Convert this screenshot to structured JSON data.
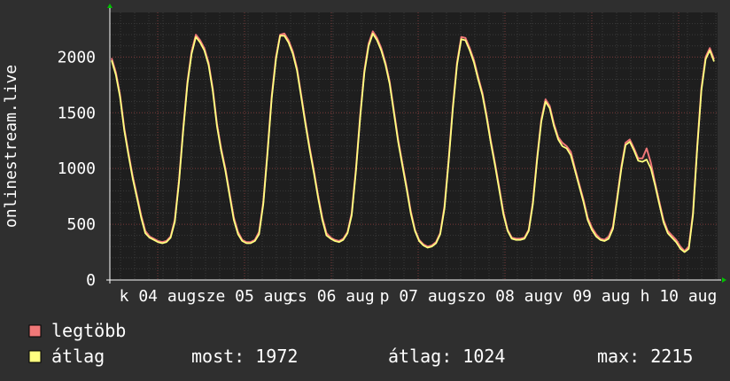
{
  "chart_data": {
    "type": "line",
    "ylabel": "onlinestream.live",
    "ylim": [
      0,
      2400
    ],
    "y_ticks": [
      0,
      500,
      1000,
      1500,
      2000
    ],
    "x_tick_labels": [
      "k 04 aug",
      "sze 05 aug",
      "cs 06 aug",
      "p 07 aug",
      "szo 08 aug",
      "v 09 aug",
      "h 10 aug"
    ],
    "grid": true,
    "colors": {
      "background": "#2f2f2f",
      "plot": "#1e1e1e",
      "grid": "#4a4a4a",
      "minor_grid": "#3a3a3a",
      "max_series": "#f07878",
      "avg_series": "#ffff80",
      "text": "#ffffff",
      "arrow": "#00c000"
    },
    "series": [
      {
        "name": "legtöbb",
        "values": [
          1990,
          1860,
          1660,
          1360,
          1140,
          930,
          760,
          580,
          440,
          390,
          370,
          350,
          340,
          350,
          390,
          540,
          900,
          1360,
          1780,
          2050,
          2200,
          2150,
          2080,
          1950,
          1720,
          1400,
          1180,
          1000,
          780,
          560,
          430,
          360,
          340,
          340,
          360,
          430,
          700,
          1150,
          1650,
          2000,
          2200,
          2210,
          2150,
          2050,
          1900,
          1660,
          1420,
          1190,
          980,
          760,
          560,
          420,
          380,
          360,
          350,
          370,
          430,
          600,
          1000,
          1480,
          1880,
          2120,
          2230,
          2170,
          2080,
          1950,
          1780,
          1520,
          1260,
          1050,
          840,
          620,
          450,
          360,
          320,
          300,
          310,
          340,
          420,
          660,
          1080,
          1560,
          1950,
          2180,
          2170,
          2080,
          1970,
          1820,
          1680,
          1480,
          1250,
          1050,
          830,
          610,
          450,
          380,
          370,
          370,
          380,
          450,
          700,
          1100,
          1440,
          1620,
          1560,
          1400,
          1280,
          1230,
          1200,
          1150,
          1000,
          860,
          720,
          560,
          470,
          410,
          370,
          360,
          390,
          480,
          740,
          1020,
          1230,
          1260,
          1180,
          1090,
          1090,
          1180,
          1050,
          870,
          700,
          540,
          440,
          400,
          360,
          300,
          260,
          300,
          600,
          1200,
          1720,
          2000,
          2080,
          1980
        ],
        "color": "#f07878"
      },
      {
        "name": "átlag",
        "values": [
          1970,
          1840,
          1640,
          1340,
          1120,
          910,
          740,
          560,
          420,
          380,
          360,
          340,
          330,
          340,
          380,
          520,
          880,
          1340,
          1760,
          2030,
          2180,
          2130,
          2060,
          1930,
          1700,
          1380,
          1160,
          980,
          760,
          540,
          410,
          350,
          330,
          330,
          350,
          410,
          680,
          1130,
          1630,
          1980,
          2190,
          2190,
          2130,
          2030,
          1880,
          1640,
          1400,
          1170,
          960,
          740,
          540,
          400,
          370,
          350,
          340,
          360,
          420,
          580,
          980,
          1460,
          1860,
          2100,
          2210,
          2150,
          2060,
          1930,
          1760,
          1500,
          1240,
          1030,
          820,
          600,
          440,
          350,
          310,
          290,
          300,
          330,
          410,
          640,
          1060,
          1540,
          1930,
          2160,
          2150,
          2060,
          1950,
          1800,
          1660,
          1460,
          1230,
          1030,
          810,
          590,
          440,
          370,
          360,
          360,
          370,
          440,
          680,
          1080,
          1420,
          1600,
          1540,
          1380,
          1260,
          1200,
          1180,
          1120,
          980,
          840,
          700,
          540,
          450,
          390,
          360,
          350,
          370,
          460,
          720,
          1000,
          1210,
          1240,
          1160,
          1070,
          1060,
          1080,
          1000,
          850,
          680,
          520,
          420,
          380,
          340,
          280,
          250,
          280,
          580,
          1180,
          1700,
          1980,
          2060,
          1960
        ]
      }
    ]
  },
  "legend": {
    "items": [
      {
        "label": "legtöbb",
        "color": "#f07878"
      },
      {
        "label": "átlag",
        "color": "#ffff80"
      }
    ],
    "stats": [
      {
        "label": "most:",
        "value": "1972"
      },
      {
        "label": "átlag:",
        "value": "1024"
      },
      {
        "label": "max:",
        "value": "2215"
      }
    ]
  }
}
